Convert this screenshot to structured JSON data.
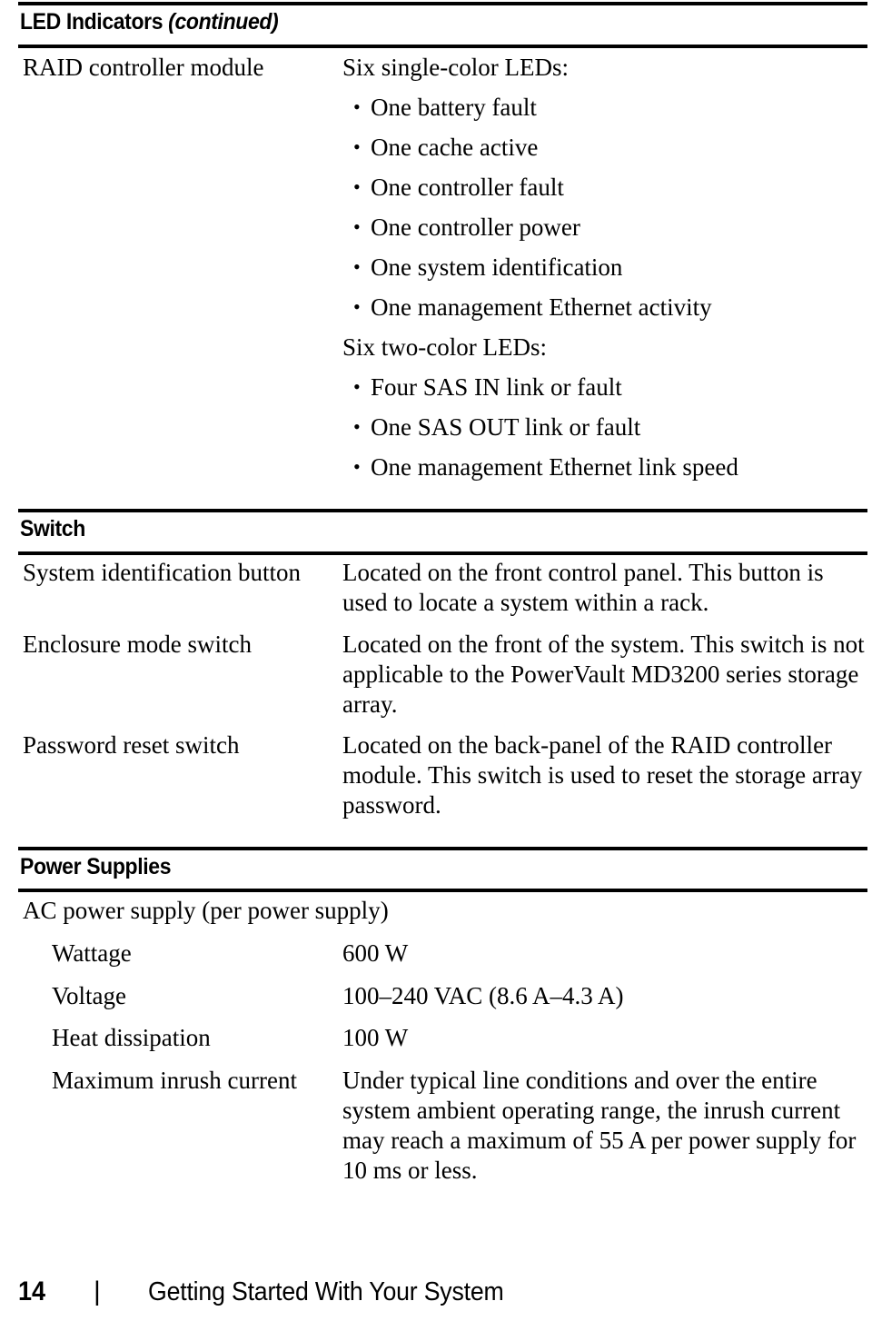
{
  "page": {
    "number": "14",
    "separator": "|",
    "footer_title": "Getting Started With Your System"
  },
  "sections": [
    {
      "id": "led-indicators",
      "title": "LED Indicators",
      "title_continued": "(continued)",
      "rows": [
        {
          "label": "RAID controller module",
          "blocks": [
            {
              "type": "text",
              "value": "Six single-color LEDs:"
            },
            {
              "type": "bullet",
              "value": "One battery fault"
            },
            {
              "type": "bullet",
              "value": "One cache active"
            },
            {
              "type": "bullet",
              "value": "One controller fault"
            },
            {
              "type": "bullet",
              "value": "One controller power"
            },
            {
              "type": "bullet",
              "value": "One system identification"
            },
            {
              "type": "bullet",
              "value": "One management Ethernet activity"
            },
            {
              "type": "text",
              "value": "Six two-color LEDs:"
            },
            {
              "type": "bullet",
              "value": "Four SAS IN link or fault"
            },
            {
              "type": "bullet",
              "value": "One SAS OUT link or fault"
            },
            {
              "type": "bullet",
              "value": "One management Ethernet link speed"
            }
          ]
        }
      ]
    },
    {
      "id": "switch",
      "title": "Switch",
      "title_continued": "",
      "rows": [
        {
          "label": "System identification button",
          "value": "Located on the front control panel. This button is used to locate a system within a rack."
        },
        {
          "label": "Enclosure mode switch",
          "value": "Located on the front of the system. This switch is not applicable to the PowerVault MD3200 series storage array."
        },
        {
          "label": "Password reset switch",
          "value": "Located on the back-panel of the RAID controller module. This switch is used to reset the storage array password."
        }
      ]
    },
    {
      "id": "power-supplies",
      "title": "Power Supplies",
      "title_continued": "",
      "group_label": "AC power supply (per power supply)",
      "rows": [
        {
          "label": "Wattage",
          "value": "600 W"
        },
        {
          "label": "Voltage",
          "value": "100–240 VAC (8.6 A–4.3 A)"
        },
        {
          "label": "Heat dissipation",
          "value": "100 W"
        },
        {
          "label": "Maximum inrush current",
          "value": "Under typical line conditions and over the entire system ambient operating range, the inrush current may reach a maximum of 55 A per power supply for 10 ms or less."
        }
      ]
    }
  ]
}
